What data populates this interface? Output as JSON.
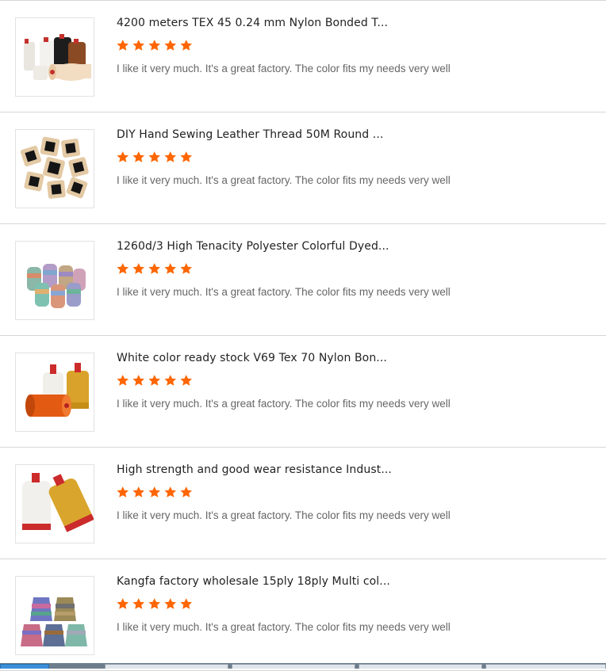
{
  "colors": {
    "star": "#ff6600",
    "divider": "#d6d6d6",
    "title_text": "#222222",
    "review_text": "#666666"
  },
  "reviews": [
    {
      "title": "4200 meters TEX 45 0.24 mm Nylon Bonded T...",
      "rating": 5,
      "text": "I like it very much. It's a great factory. The color fits my needs very well",
      "thumbnail": "spools-white-black-beige-brown-icon"
    },
    {
      "title": "DIY Hand Sewing Leather Thread 50M Round ...",
      "rating": 5,
      "text": "I like it very much. It's a great factory. The color fits my needs very well",
      "thumbnail": "thread-cards-icon"
    },
    {
      "title": "1260d/3 High Tenacity Polyester Colorful Dyed...",
      "rating": 5,
      "text": "I like it very much. It's a great factory. The color fits my needs very well",
      "thumbnail": "multicolor-spools-icon"
    },
    {
      "title": "White color ready stock V69 Tex 70 Nylon Bon...",
      "rating": 5,
      "text": "I like it very much. It's a great factory. The color fits my needs very well",
      "thumbnail": "orange-white-gold-spools-icon"
    },
    {
      "title": "High strength and good wear resistance Indust...",
      "rating": 5,
      "text": "I like it very much. It's a great factory. The color fits my needs very well",
      "thumbnail": "white-gold-spools-icon"
    },
    {
      "title": "Kangfa factory wholesale 15ply 18ply Multi col...",
      "rating": 5,
      "text": "I like it very much. It's a great factory. The color fits my needs very well",
      "thumbnail": "multicolor-cones-icon"
    }
  ]
}
